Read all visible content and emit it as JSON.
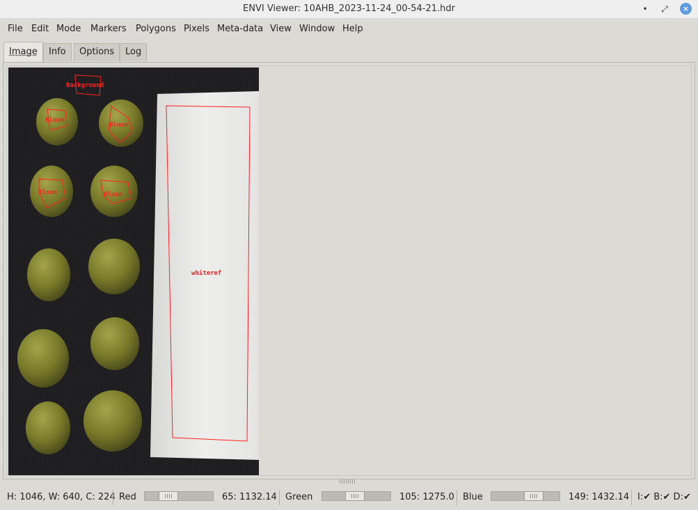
{
  "window": {
    "title": "ENVI Viewer: 10AHB_2023-11-24_00-54-21.hdr",
    "minimize_glyph": "•",
    "maximize_glyph": "⤢",
    "close_glyph": "×"
  },
  "menu": [
    "File",
    "Edit",
    "Mode",
    "Markers",
    "Polygons",
    "Pixels",
    "Meta-data",
    "View",
    "Window",
    "Help"
  ],
  "tabs": [
    {
      "label": "Image",
      "active": true
    },
    {
      "label": "Info",
      "active": false
    },
    {
      "label": "Options",
      "active": false
    },
    {
      "label": "Log",
      "active": false
    }
  ],
  "image": {
    "polygon_labels": [
      "Background",
      "Bloom",
      "Bloom",
      "Bloom",
      "Bloom",
      "whiteref"
    ],
    "polygon_color": "#ff2020"
  },
  "status": {
    "dims": "H: 1046, W: 640, C: 224",
    "red_label": "Red",
    "red_value": "65: 1132.14",
    "red_level": 0.29,
    "green_label": "Green",
    "green_value": "105: 1275.0",
    "green_level": 0.47,
    "blue_label": "Blue",
    "blue_value": "149: 1432.14",
    "blue_level": 0.67,
    "flags": "I:✔ B:✔ D:✔"
  }
}
